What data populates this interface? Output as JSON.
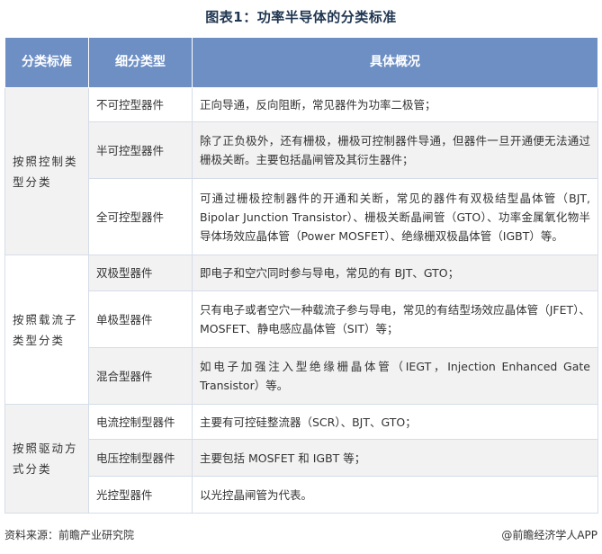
{
  "title": "图表1：功率半导体的分类标准",
  "headers": [
    "分类标准",
    "细分类型",
    "具体概况"
  ],
  "groups": [
    {
      "category": "按照控制类型分类",
      "rows": [
        {
          "sub": "不可控型器件",
          "desc": "正向导通，反向阻断，常见器件为功率二极管；"
        },
        {
          "sub": "半可控型器件",
          "desc": "除了正负极外，还有栅极，栅极可控制器件导通，但器件一旦开通便无法通过栅极关断。主要包括晶闸管及其衍生器件；"
        },
        {
          "sub": "全可控型器件",
          "desc": "可通过栅极控制器件的开通和关断，常见的器件有双极结型晶体管（BJT, Bipolar Junction Transistor）、栅极关断晶闸管（GTO）、功率金属氧化物半导体场效应晶体管（Power MOSFET）、绝缘栅双极晶体管（IGBT）等。"
        }
      ]
    },
    {
      "category": "按照载流子类型分类",
      "rows": [
        {
          "sub": "双极型器件",
          "desc": "即电子和空穴同时参与导电，常见的有 BJT、GTO；"
        },
        {
          "sub": "单极型器件",
          "desc": "只有电子或者空穴一种载流子参与导电，常见的有结型场效应晶体管（JFET）、MOSFET、静电感应晶体管（SIT）等；"
        },
        {
          "sub": "混合型器件",
          "desc": "如电子加强注入型绝缘栅晶体管（IEGT，Injection Enhanced Gate Transistor）等。"
        }
      ]
    },
    {
      "category": "按照驱动方式分类",
      "rows": [
        {
          "sub": "电流控制型器件",
          "desc": "主要有可控硅整流器（SCR）、BJT、GTO；"
        },
        {
          "sub": "电压控制型器件",
          "desc": "主要包括 MOSFET 和 IGBT 等；"
        },
        {
          "sub": "光控型器件",
          "desc": "以光控晶闸管为代表。"
        }
      ]
    }
  ],
  "footer": {
    "source": "资料来源：前瞻产业研究院",
    "brand": "@前瞻经济学人APP"
  },
  "colors": {
    "header_bg": "#6d8fc4",
    "shade_bg": "#f2f2f2",
    "title": "#1f3550"
  }
}
